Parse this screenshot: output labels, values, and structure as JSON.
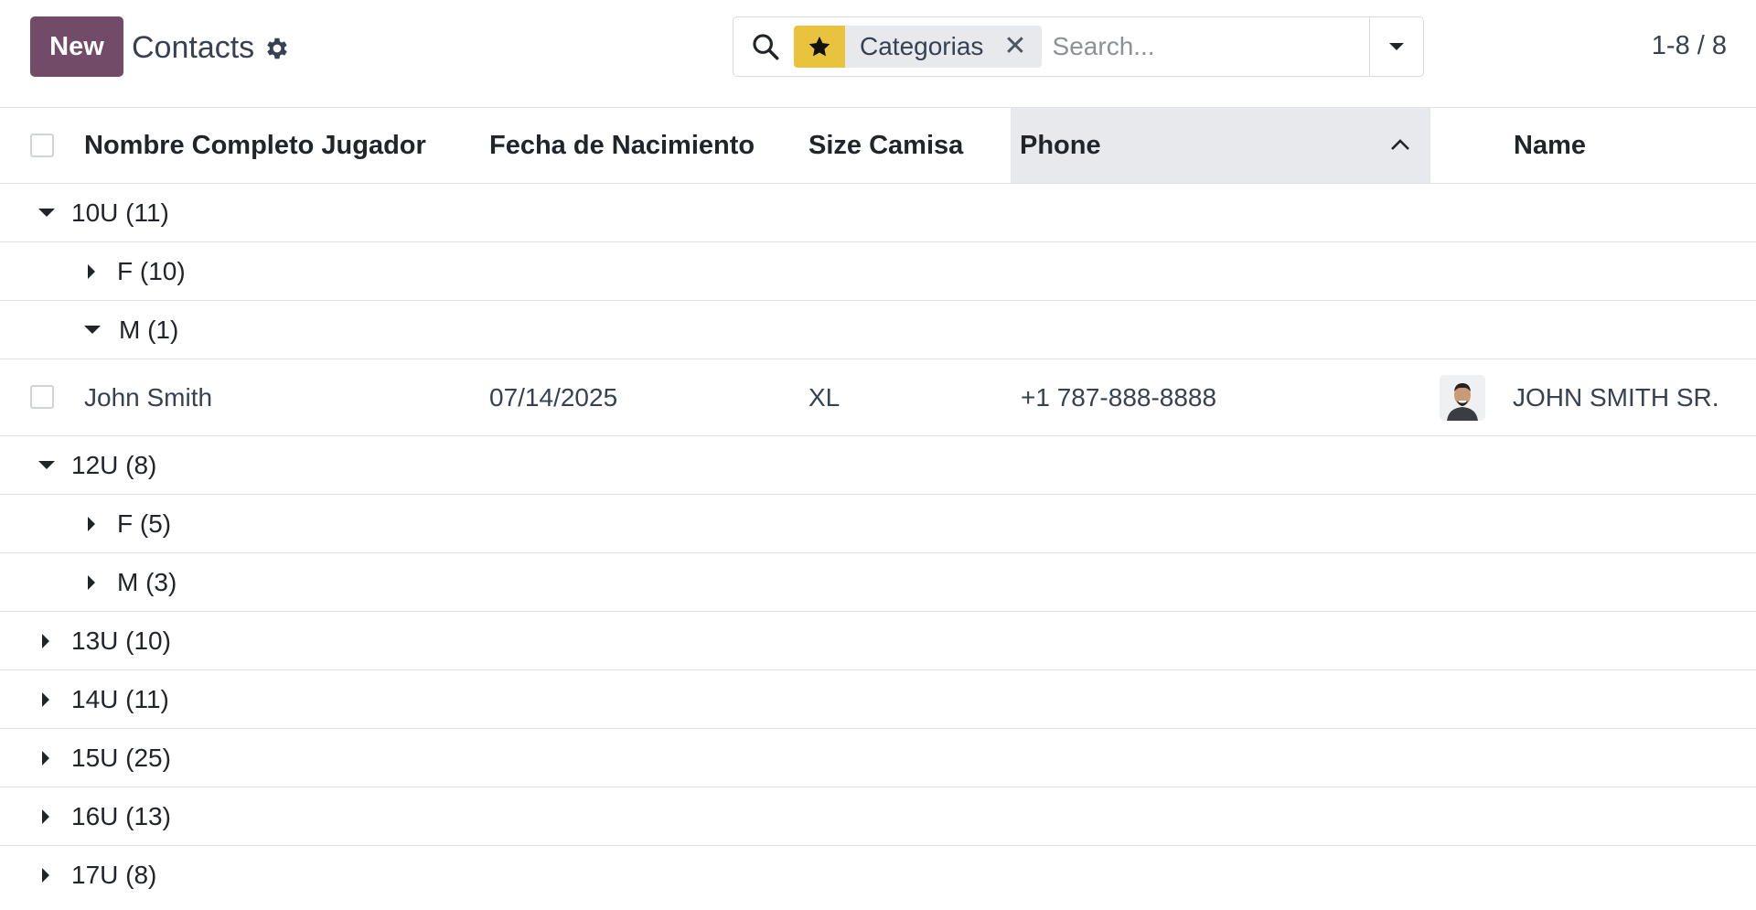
{
  "control_panel": {
    "new_button": "New",
    "title": "Contacts",
    "search": {
      "facet_icon": "star-icon",
      "facet_label": "Categorias",
      "placeholder": "Search..."
    },
    "pager": "1-8 / 8"
  },
  "list": {
    "columns": [
      "Nombre Completo Jugador",
      "Fecha de Nacimiento",
      "Size Camisa",
      "Phone",
      "Name"
    ],
    "sorted_column": "Phone",
    "sort_direction": "ascending",
    "groups": [
      {
        "label": "10U (11)",
        "expanded": true,
        "subgroups": [
          {
            "label": "F (10)",
            "expanded": false
          },
          {
            "label": "M (1)",
            "expanded": true
          }
        ]
      },
      {
        "label": "12U (8)",
        "expanded": true,
        "subgroups": [
          {
            "label": "F (5)",
            "expanded": false
          },
          {
            "label": "M (3)",
            "expanded": false
          }
        ]
      },
      {
        "label": "13U (10)",
        "expanded": false
      },
      {
        "label": "14U (11)",
        "expanded": false
      },
      {
        "label": "15U (25)",
        "expanded": false
      },
      {
        "label": "16U (13)",
        "expanded": false
      },
      {
        "label": "17U (8)",
        "expanded": false
      }
    ],
    "record": {
      "nombre": "John Smith",
      "fecha": "07/14/2025",
      "size": "XL",
      "phone": "+1 787-888-8888",
      "name": "JOHN SMITH SR."
    }
  },
  "colors": {
    "primary": "#714b67",
    "facet_accent": "#e9c33e"
  }
}
